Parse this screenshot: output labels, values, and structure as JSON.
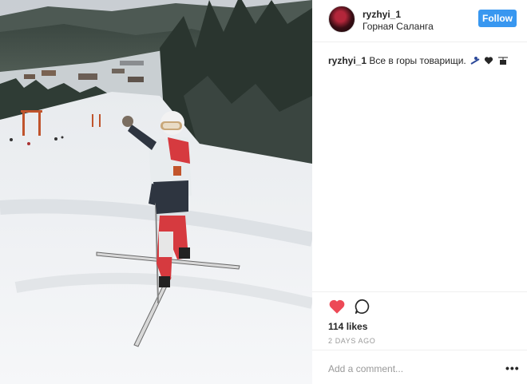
{
  "post": {
    "username": "ryzhyi_1",
    "location": "Горная Саланга",
    "follow_label": "Follow",
    "caption_text": "Все в горы товарищи.",
    "caption_emojis": [
      "skier",
      "black-heart",
      "mountain-cableway"
    ],
    "likes": "114 likes",
    "time_ago": "2 DAYS AGO",
    "comment_placeholder": "Add a comment...",
    "more_label": "•••"
  },
  "colors": {
    "follow_blue": "#3897f0",
    "like_red": "#ed4956",
    "text": "#262626",
    "muted": "#999999"
  },
  "icons": {
    "like": "heart-filled-icon",
    "comment": "speech-bubble-icon",
    "more": "ellipsis-icon"
  }
}
